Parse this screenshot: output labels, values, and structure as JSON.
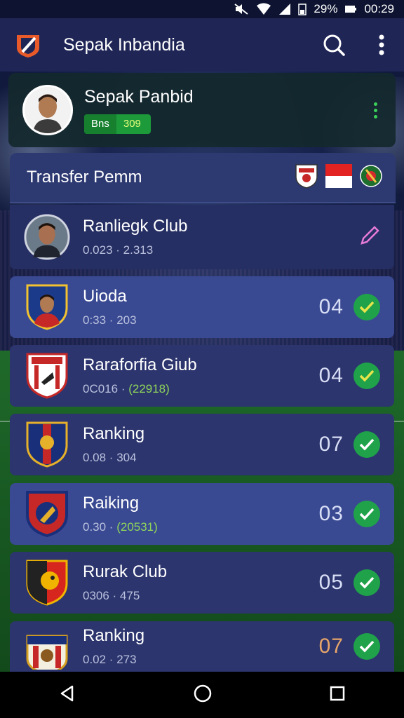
{
  "status_bar": {
    "battery": "29%",
    "time": "00:29"
  },
  "app_bar": {
    "title": "Sepak Inbandia"
  },
  "profile": {
    "name": "Sepak Panbid",
    "badge_left": "Bns",
    "badge_right": "309"
  },
  "transfer": {
    "title": "Transfer Pemm"
  },
  "rows": [
    {
      "name": "Ranliegk Club",
      "meta": "0.023 · 2.313",
      "meta_extra": "",
      "rank": ""
    },
    {
      "name": "Uioda",
      "meta": "0:33 · 203",
      "meta_extra": "",
      "rank": "04"
    },
    {
      "name": "Raraforfia Giub",
      "meta": "0C016 · ",
      "meta_extra": "(22918)",
      "rank": "04"
    },
    {
      "name": "Ranking",
      "meta": "0.08 · 304",
      "meta_extra": "",
      "rank": "07"
    },
    {
      "name": "Raiking",
      "meta": "0.30 · ",
      "meta_extra": "(20531)",
      "rank": "03"
    },
    {
      "name": "Rurak Club",
      "meta": "0306 · 475",
      "meta_extra": "",
      "rank": "05"
    },
    {
      "name": "Ranking",
      "meta": "0.02 · 273",
      "meta_extra": "",
      "rank": "07"
    }
  ],
  "colors": {
    "accent_green": "#1fa24a",
    "app_bar": "#1f2656",
    "row": "#2c356d",
    "row_highlight": "#3a4a92"
  }
}
